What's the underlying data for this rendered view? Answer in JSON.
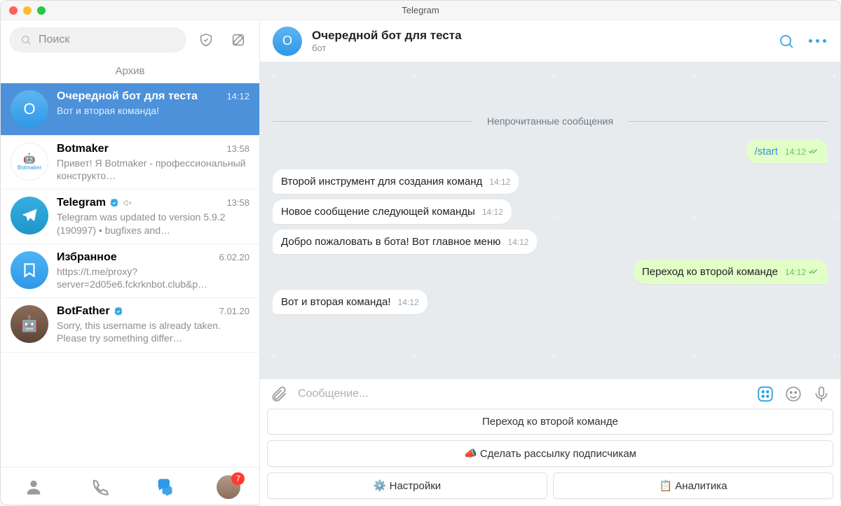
{
  "window": {
    "title": "Telegram"
  },
  "sidebar": {
    "search_placeholder": "Поиск",
    "archive_label": "Архив",
    "chats": [
      {
        "name": "Очередной бот для теста",
        "preview": "Вот и вторая команда!",
        "time": "14:12",
        "avatar_letter": "О",
        "selected": true
      },
      {
        "name": "Botmaker",
        "preview": "Привет! Я Botmaker - профессиональный конструкто…",
        "time": "13:58"
      },
      {
        "name": "Telegram",
        "preview": "Telegram was updated to version 5.9.2 (190997)    •  bugfixes and…",
        "time": "13:58",
        "verified": true
      },
      {
        "name": "Избранное",
        "preview": "https://t.me/proxy?server=2d05e6.fckrknbot.club&p…",
        "time": "6.02.20"
      },
      {
        "name": "BotFather",
        "preview": "Sorry, this username is already taken. Please try something differ…",
        "time": "7.01.20",
        "verified": true
      }
    ],
    "tabs_badge": "7"
  },
  "header": {
    "name": "Очередной бот для теста",
    "subtitle": "бот",
    "avatar_letter": "О"
  },
  "chat": {
    "unread_label": "Непрочитанные сообщения",
    "messages": [
      {
        "side": "out",
        "text": "/start",
        "time": "14:12",
        "link": true
      },
      {
        "side": "in",
        "text": "Второй инструмент для создания команд",
        "time": "14:12"
      },
      {
        "side": "in",
        "text": "Новое сообщение следующей команды",
        "time": "14:12"
      },
      {
        "side": "in",
        "text": "Добро пожаловать в бота! Вот главное меню",
        "time": "14:12"
      },
      {
        "side": "out",
        "text": "Переход ко второй команде",
        "time": "14:12"
      },
      {
        "side": "in",
        "text": "Вот и вторая команда!",
        "time": "14:12"
      }
    ]
  },
  "composer": {
    "placeholder": "Сообщение..."
  },
  "keyboard": {
    "buttons": [
      {
        "label": "Переход ко второй команде",
        "wide": true
      },
      {
        "label": "📣 Сделать рассылку подписчикам",
        "wide": true
      },
      {
        "label": "⚙️ Настройки"
      },
      {
        "label": "📋 Аналитика"
      }
    ]
  }
}
